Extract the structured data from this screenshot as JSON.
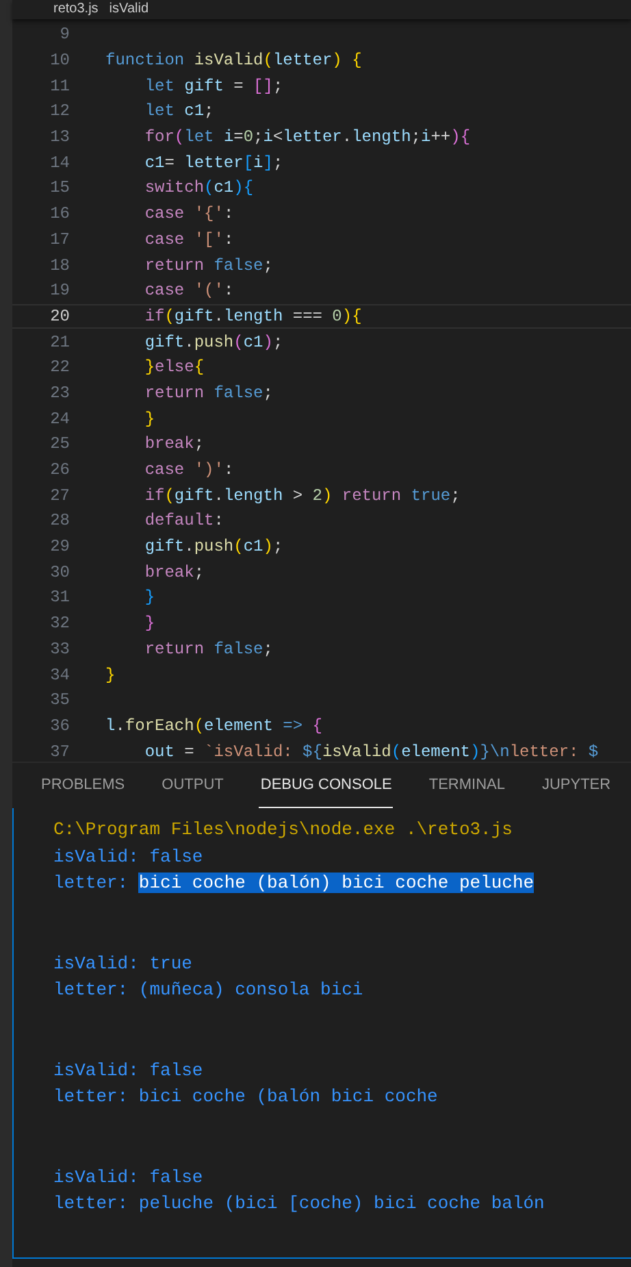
{
  "breadcrumb": {
    "file": "reto3.js",
    "symbol": "isValid"
  },
  "editor": {
    "lines": [
      {
        "number": "9",
        "current": false
      },
      {
        "number": "10",
        "current": false,
        "text": "function isValid(letter) {"
      },
      {
        "number": "11",
        "current": false,
        "text": "    let gift = [];"
      },
      {
        "number": "12",
        "current": false,
        "text": "    let c1;"
      },
      {
        "number": "13",
        "current": false,
        "text": "    for(let i=0;i<letter.length;i++){"
      },
      {
        "number": "14",
        "current": false,
        "text": "    c1= letter[i];"
      },
      {
        "number": "15",
        "current": false,
        "text": "    switch(c1){"
      },
      {
        "number": "16",
        "current": false,
        "text": "    case '{':"
      },
      {
        "number": "17",
        "current": false,
        "text": "    case '[':"
      },
      {
        "number": "18",
        "current": false,
        "text": "    return false;"
      },
      {
        "number": "19",
        "current": false,
        "text": "    case '(':"
      },
      {
        "number": "20",
        "current": true,
        "text": "    if(gift.length === 0){"
      },
      {
        "number": "21",
        "current": false,
        "text": "    gift.push(c1);"
      },
      {
        "number": "22",
        "current": false,
        "text": "    }else{"
      },
      {
        "number": "23",
        "current": false,
        "text": "    return false;"
      },
      {
        "number": "24",
        "current": false,
        "text": "    }"
      },
      {
        "number": "25",
        "current": false,
        "text": "    break;"
      },
      {
        "number": "26",
        "current": false,
        "text": "    case ')':"
      },
      {
        "number": "27",
        "current": false,
        "text": "    if(gift.length > 2) return true;"
      },
      {
        "number": "28",
        "current": false,
        "text": "    default:"
      },
      {
        "number": "29",
        "current": false,
        "text": "    gift.push(c1);"
      },
      {
        "number": "30",
        "current": false,
        "text": "    break;"
      },
      {
        "number": "31",
        "current": false,
        "text": "    }"
      },
      {
        "number": "32",
        "current": false,
        "text": "    }"
      },
      {
        "number": "33",
        "current": false,
        "text": "    return false;"
      },
      {
        "number": "34",
        "current": false,
        "text": "}"
      },
      {
        "number": "35",
        "current": false
      },
      {
        "number": "36",
        "current": false,
        "text": "l.forEach(element => {"
      },
      {
        "number": "37",
        "current": false,
        "text": "    out = `isValid: ${isValid(element)}\\nletter: $"
      }
    ]
  },
  "panel": {
    "tabs": [
      {
        "label": "PROBLEMS",
        "selected": false
      },
      {
        "label": "OUTPUT",
        "selected": false
      },
      {
        "label": "DEBUG CONSOLE",
        "selected": true
      },
      {
        "label": "TERMINAL",
        "selected": false
      },
      {
        "label": "JUPYTER",
        "selected": false
      }
    ],
    "console": [
      {
        "kind": "command",
        "segments": [
          {
            "text": "C:\\Program Files\\nodejs\\node.exe .\\reto3.js",
            "selected": false
          }
        ]
      },
      {
        "kind": "output",
        "segments": [
          {
            "text": "isValid: false",
            "selected": false
          }
        ]
      },
      {
        "kind": "output",
        "segments": [
          {
            "text": "letter: ",
            "selected": false
          },
          {
            "text": "bici coche (balón) bici coche peluche",
            "selected": true
          }
        ]
      },
      {
        "kind": "blank"
      },
      {
        "kind": "blank"
      },
      {
        "kind": "output",
        "segments": [
          {
            "text": "isValid: true",
            "selected": false
          }
        ]
      },
      {
        "kind": "output",
        "segments": [
          {
            "text": "letter: (muñeca) consola bici",
            "selected": false
          }
        ]
      },
      {
        "kind": "blank"
      },
      {
        "kind": "blank"
      },
      {
        "kind": "output",
        "segments": [
          {
            "text": "isValid: false",
            "selected": false
          }
        ]
      },
      {
        "kind": "output",
        "segments": [
          {
            "text": "letter: bici coche (balón bici coche",
            "selected": false
          }
        ]
      },
      {
        "kind": "blank"
      },
      {
        "kind": "blank"
      },
      {
        "kind": "output",
        "segments": [
          {
            "text": "isValid: false",
            "selected": false
          }
        ]
      },
      {
        "kind": "output",
        "segments": [
          {
            "text": "letter: peluche (bici [coche) bici coche balón",
            "selected": false
          }
        ]
      }
    ]
  }
}
